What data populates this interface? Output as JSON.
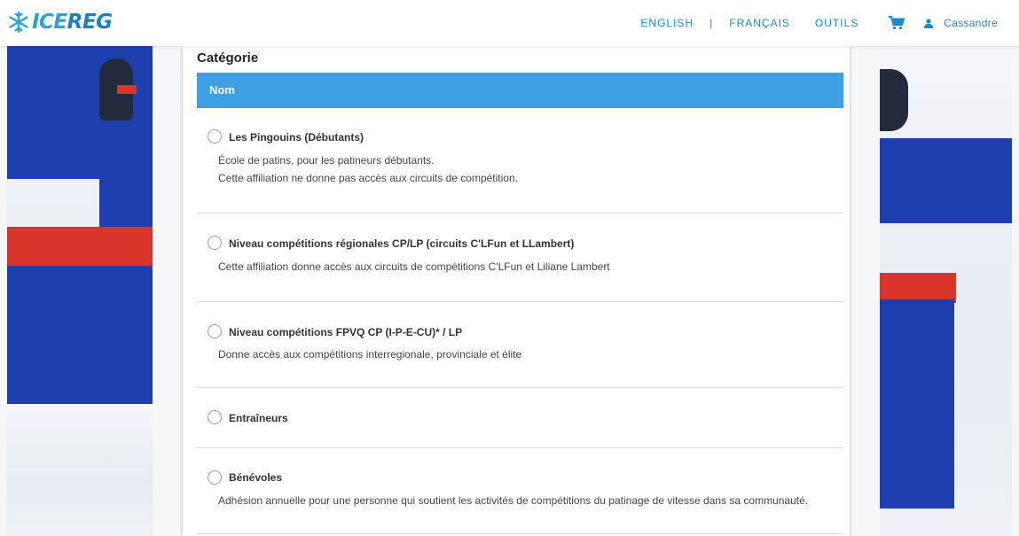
{
  "header": {
    "logo": {
      "part1": "ICE",
      "part2": "REG"
    },
    "nav": {
      "english": "ENGLISH",
      "separator": "|",
      "francais": "FRANÇAIS",
      "outils": "OUTILS"
    },
    "user": {
      "name": "Cassandre"
    }
  },
  "card": {
    "title": "Catégorie",
    "table_header": "Nom",
    "rows": [
      {
        "label": "Les Pingouins (Débutants)",
        "desc1": "École de patins, pour les patineurs débutants.",
        "desc2": "Cette affiliation ne donne pas accès aux circuits de compétition."
      },
      {
        "label": "Niveau compétitions régionales CP/LP (circuits C'LFun et LLambert)",
        "desc1": "Cette affiliation donne accès aux circuits de compétitions C'LFun et Liliane Lambert"
      },
      {
        "label": "Niveau compétitions FPVQ CP (I-P-E-CU)* / LP",
        "desc1": "Donne accès aux compétitions interregionale, provinciale et élite"
      },
      {
        "label": "Entraîneurs"
      },
      {
        "label": "Bénévoles",
        "desc1": "Adhésion annuelle pour une personne qui soutient les activités de compétitions du patinage de vitesse dans sa communauté."
      }
    ]
  },
  "colors": {
    "accent": "#3f9fe3",
    "link": "#1a8ad0",
    "logo": "#2aa3db"
  }
}
